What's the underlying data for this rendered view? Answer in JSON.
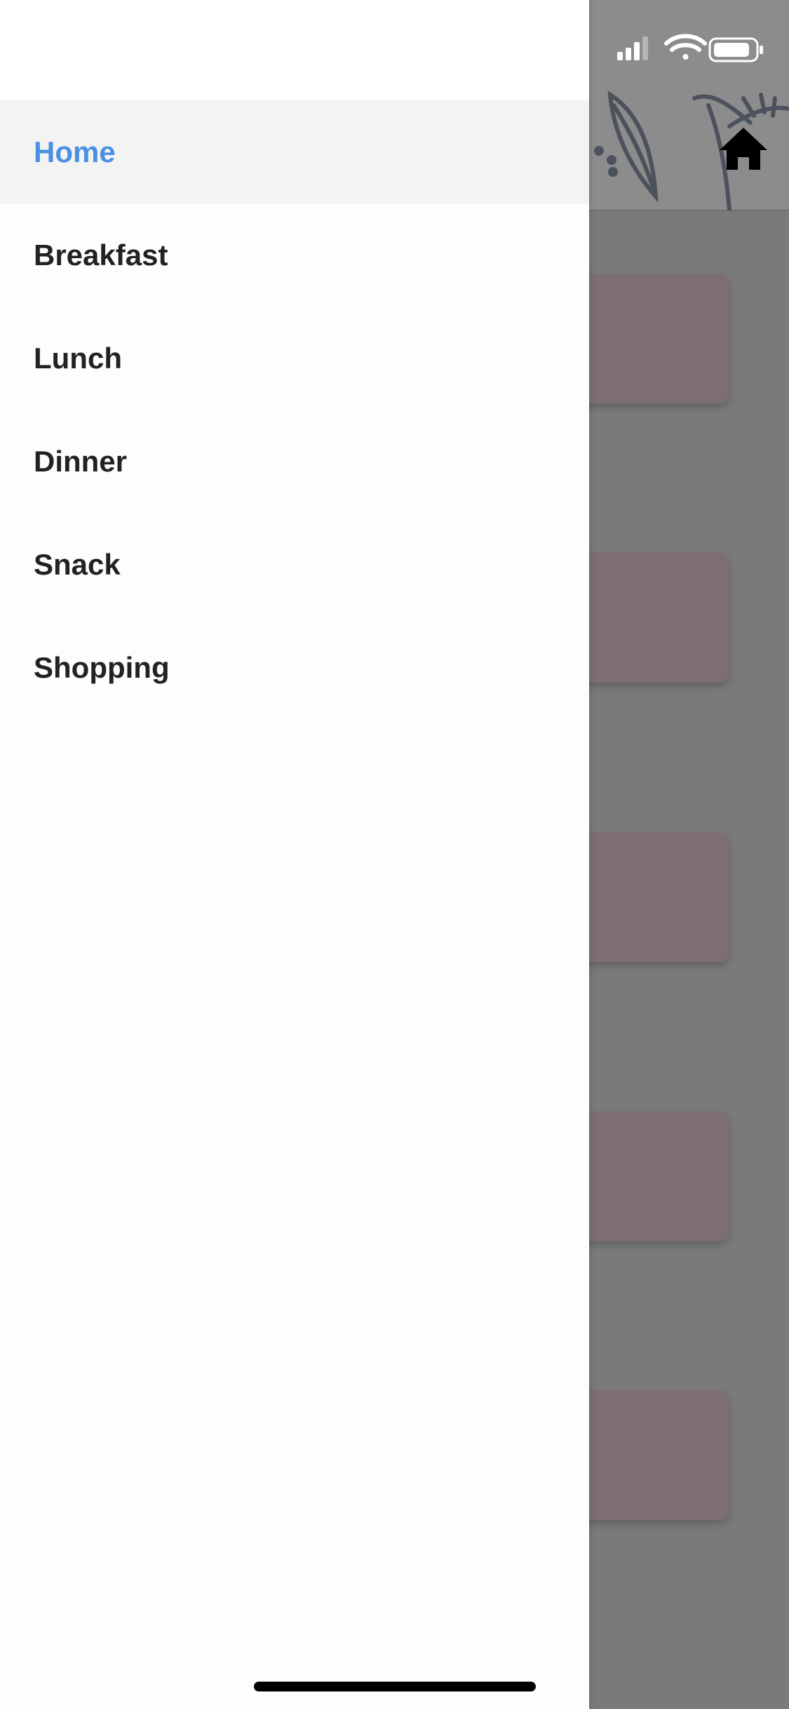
{
  "drawer": {
    "items": [
      {
        "label": "Home",
        "active": true
      },
      {
        "label": "Breakfast",
        "active": false
      },
      {
        "label": "Lunch",
        "active": false
      },
      {
        "label": "Dinner",
        "active": false
      },
      {
        "label": "Snack",
        "active": false
      },
      {
        "label": "Shopping",
        "active": false
      }
    ]
  },
  "colors": {
    "active_item_text": "#4a90e2",
    "item_text": "#222222",
    "overlay": "#7a7a7a",
    "card": "#7d6e72"
  },
  "icons": {
    "status": [
      "cellular-signal-icon",
      "wifi-icon",
      "battery-icon"
    ],
    "header": [
      "leaf-illustration-icon",
      "home-icon"
    ]
  }
}
